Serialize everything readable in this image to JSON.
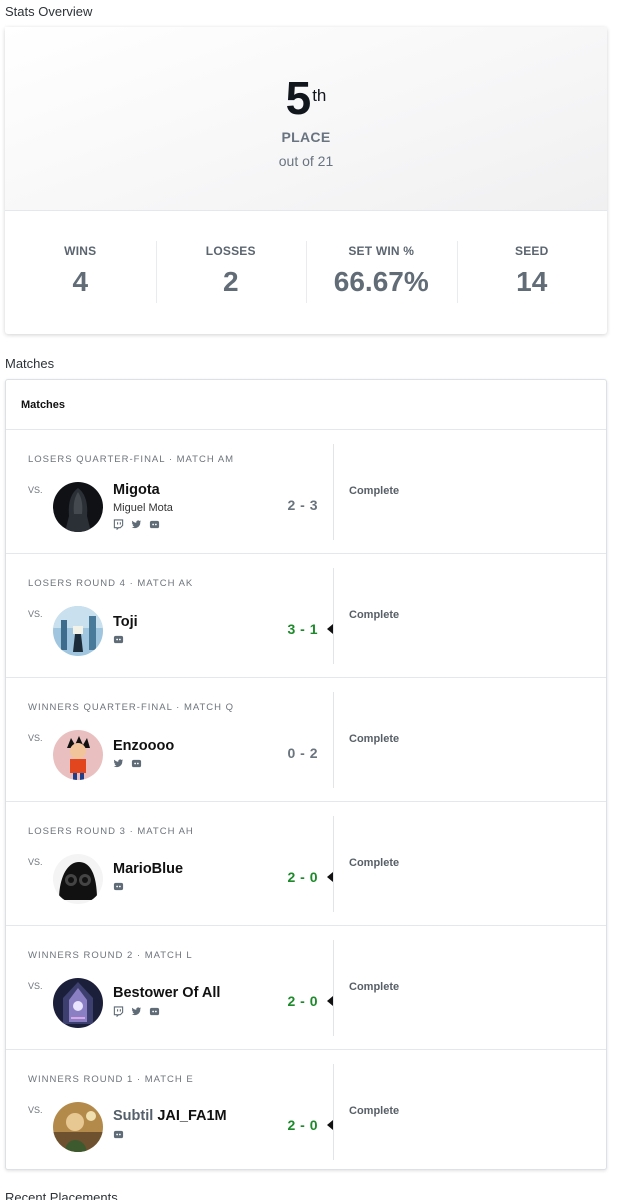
{
  "stats_overview": {
    "title": "Stats Overview",
    "place": "5",
    "place_suffix": "th",
    "place_label": "PLACE",
    "out_of": "out of 21",
    "stats": [
      {
        "label": "WINS",
        "value": "4"
      },
      {
        "label": "LOSSES",
        "value": "2"
      },
      {
        "label": "SET WIN %",
        "value": "66.67%"
      },
      {
        "label": "SEED",
        "value": "14"
      }
    ]
  },
  "matches": {
    "section_title": "Matches",
    "card_title": "Matches",
    "items": [
      {
        "round": "LOSERS QUARTER-FINAL · MATCH AM",
        "vs": "VS.",
        "prefix": "",
        "name": "Migota",
        "real_name": "Miguel Mota",
        "socials": [
          "twitch-icon",
          "twitter-icon",
          "discord-icon"
        ],
        "score": "2 - 3",
        "won": false,
        "status": "Complete"
      },
      {
        "round": "LOSERS ROUND 4 · MATCH AK",
        "vs": "VS.",
        "prefix": "",
        "name": "Toji",
        "real_name": "",
        "socials": [
          "discord-icon"
        ],
        "score": "3 - 1",
        "won": true,
        "status": "Complete"
      },
      {
        "round": "WINNERS QUARTER-FINAL · MATCH Q",
        "vs": "VS.",
        "prefix": "",
        "name": "Enzoooo",
        "real_name": "",
        "socials": [
          "twitter-icon",
          "discord-icon"
        ],
        "score": "0 - 2",
        "won": false,
        "status": "Complete"
      },
      {
        "round": "LOSERS ROUND 3 · MATCH AH",
        "vs": "VS.",
        "prefix": "",
        "name": "MarioBlue",
        "real_name": "",
        "socials": [
          "discord-icon"
        ],
        "score": "2 - 0",
        "won": true,
        "status": "Complete"
      },
      {
        "round": "WINNERS ROUND 2 · MATCH L",
        "vs": "VS.",
        "prefix": "",
        "name": "Bestower Of All",
        "real_name": "",
        "socials": [
          "twitch-icon",
          "twitter-icon",
          "discord-icon"
        ],
        "score": "2 - 0",
        "won": true,
        "status": "Complete"
      },
      {
        "round": "WINNERS ROUND 1 · MATCH E",
        "vs": "VS.",
        "prefix": "Subtil",
        "name": "JAI_FA1M",
        "real_name": "",
        "socials": [
          "discord-icon"
        ],
        "score": "2 - 0",
        "won": true,
        "status": "Complete"
      }
    ]
  },
  "recent_placements": {
    "title": "Recent Placements"
  },
  "colors": {
    "win_score": "#1c8a2a",
    "loss_score": "#6a747e"
  }
}
